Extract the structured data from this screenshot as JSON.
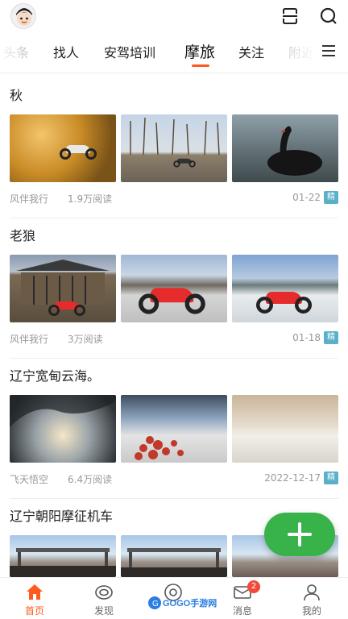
{
  "tabs": [
    "头条",
    "找人",
    "安驾培训",
    "摩旅",
    "关注",
    "附近"
  ],
  "active_tab": "摩旅",
  "header_icons": [
    "avatar",
    "scan-icon",
    "search-icon"
  ],
  "menu_icon": "menu-icon",
  "feed": [
    {
      "title": "秋",
      "author": "风伴我行",
      "reads": "1.9万阅读",
      "date": "01-22",
      "badge": "精"
    },
    {
      "title": "老狼",
      "author": "风伴我行",
      "reads": "3万阅读",
      "date": "01-18",
      "badge": "精"
    },
    {
      "title": "辽宁宽甸云海。",
      "author": "飞天悟空",
      "reads": "6.4万阅读",
      "date": "2022-12-17",
      "badge": "精"
    },
    {
      "title": "辽宁朝阳摩征机车"
    }
  ],
  "fab": {
    "icon": "plus-icon"
  },
  "nav": [
    {
      "label": "首页",
      "icon": "home-icon"
    },
    {
      "label": "发现",
      "icon": "discover-icon"
    },
    {
      "label": "",
      "icon": "eye-icon"
    },
    {
      "label": "消息",
      "icon": "mail-icon",
      "count": "2"
    },
    {
      "label": "我的",
      "icon": "user-icon"
    }
  ],
  "watermark": "GOGO手游网",
  "colors": {
    "accent": "#ff5a1f",
    "fab": "#37b34a",
    "badge": "#5ab0c9",
    "count_badge": "#f04a3a"
  }
}
